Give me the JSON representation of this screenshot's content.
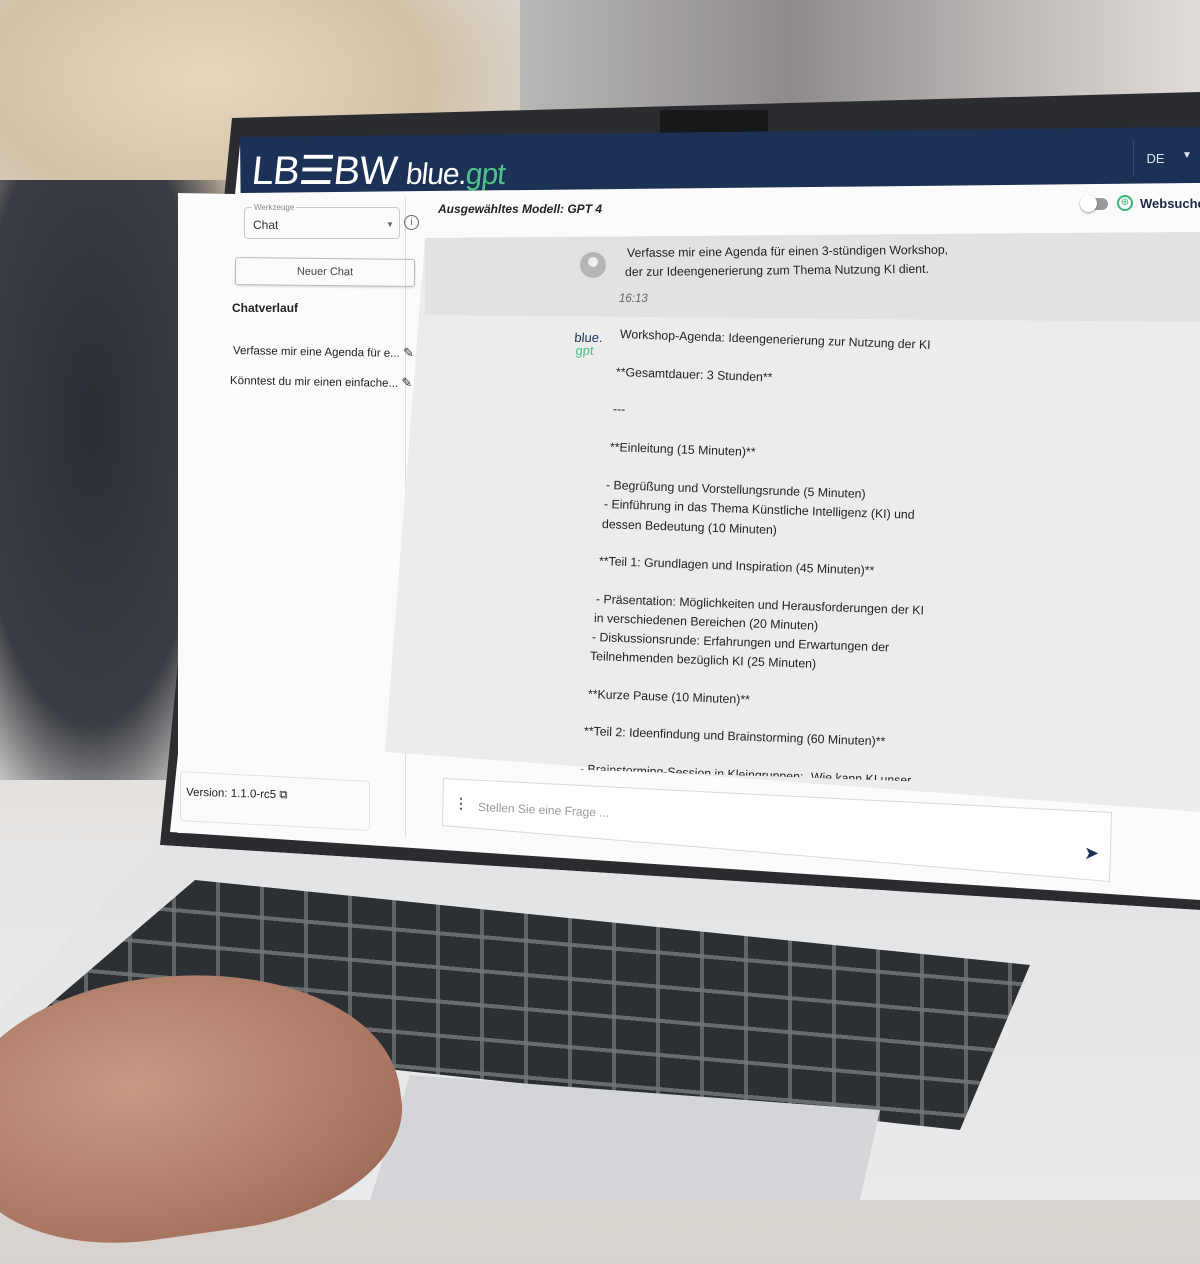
{
  "app": {
    "brand_left": "LB",
    "brand_mark": "☰",
    "brand_right": "BW",
    "product_blue": "blue.",
    "product_gpt": "gpt",
    "language": "DE",
    "accent_navy": "#1b3155",
    "accent_green": "#4dc28a"
  },
  "sidebar": {
    "tools_label": "Werkzeuge",
    "tools_value": "Chat",
    "new_chat": "Neuer Chat",
    "history_title": "Chatverlauf",
    "history": [
      {
        "label": "Verfasse mir eine Agenda für e..."
      },
      {
        "label": "Könntest du mir einen einfache..."
      }
    ],
    "version": "Version: 1.1.0-rc5"
  },
  "main": {
    "model": "Ausgewähltes Modell: GPT 4",
    "websearch": "Websuche",
    "websearch_enabled": false,
    "user_message": [
      "Verfasse mir eine Agenda für einen 3-stündigen Workshop,",
      "der zur Ideengenerierung zum Thema Nutzung KI dient."
    ],
    "user_time": "16:13",
    "bot_logo_blue": "blue.",
    "bot_logo_gpt": "gpt",
    "bot_lines": [
      "Workshop-Agenda: Ideengenerierung zur Nutzung der KI",
      "**Gesamtdauer: 3 Stunden**",
      "---",
      "**Einleitung (15 Minuten)**",
      "- Begrüßung und Vorstellungsrunde (5 Minuten)",
      "- Einführung in das Thema Künstliche Intelligenz (KI) und",
      "dessen Bedeutung (10 Minuten)",
      "**Teil 1: Grundlagen und Inspiration (45 Minuten)**",
      "- Präsentation: Möglichkeiten und Herausforderungen der KI",
      "in verschiedenen Bereichen (20 Minuten)",
      "- Diskussionsrunde: Erfahrungen und Erwartungen der",
      "Teilnehmenden bezüglich KI (25 Minuten)",
      "**Kurze Pause (10 Minuten)**",
      "**Teil 2: Ideenfindung und Brainstorming (60 Minuten)**",
      "- Brainstorming-Session in Kleingruppen: „Wie kann KI unser"
    ],
    "input_placeholder": "Stellen Sie eine Frage ..."
  }
}
